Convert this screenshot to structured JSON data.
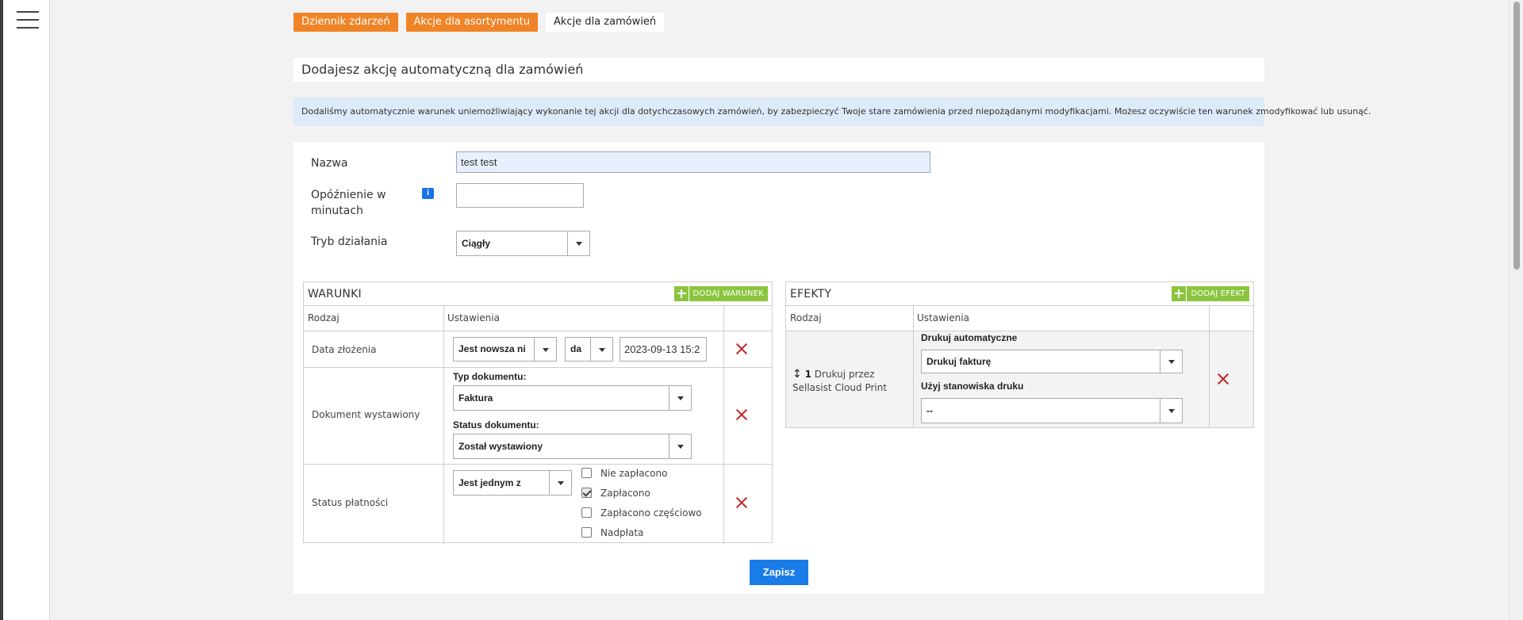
{
  "nav": {
    "menu_icon": "hamburger-menu-icon"
  },
  "tabs": [
    {
      "label": "Dziennik zdarzeń"
    },
    {
      "label": "Akcje dla asortymentu"
    },
    {
      "label": "Akcje dla zamówień"
    }
  ],
  "page_title": "Dodajesz akcję automatyczną dla zamówień",
  "info_message": "Dodaliśmy automatycznie warunek uniemożliwiający wykonanie tej akcji dla dotychczasowych zamówień, by zabezpieczyć Twoje stare zamówienia przed niepożądanymi modyfikacjami. Możesz oczywiście ten warunek zmodyfikować lub usunąć.",
  "form": {
    "name_label": "Nazwa",
    "name_value": "test test",
    "delay_label_line1": "Opóźnienie w",
    "delay_label_line2": "minutach",
    "delay_value": "",
    "delay_info_icon": "i",
    "mode_label": "Tryb działania",
    "mode_value": "Ciągły"
  },
  "conditions": {
    "title": "WARUNKI",
    "add_label": "DODAJ WARUNEK",
    "col_type": "Rodzaj",
    "col_settings": "Ustawienia",
    "rows": [
      {
        "label": "Data złożenia",
        "operator": "Jest nowsza ni",
        "unit": "da",
        "date": "2023-09-13 15:2"
      },
      {
        "label": "Dokument wystawiony",
        "doc_type_label": "Typ dokumentu:",
        "doc_type_value": "Faktura",
        "doc_status_label": "Status dokumentu:",
        "doc_status_value": "Został wystawiony"
      },
      {
        "label": "Status płatności",
        "operator": "Jest jednym z",
        "options": [
          {
            "label": "Nie zapłacono",
            "checked": false
          },
          {
            "label": "Zapłacono",
            "checked": true
          },
          {
            "label": "Zapłacono częściowo",
            "checked": false
          },
          {
            "label": "Nadpłata",
            "checked": false
          }
        ]
      }
    ]
  },
  "effects": {
    "title": "EFEKTY",
    "add_label": "DODAJ EFEKT",
    "col_type": "Rodzaj",
    "col_settings": "Ustawienia",
    "rows": [
      {
        "drag_icon": "↕",
        "count": "1",
        "label_line1": "Drukuj przez",
        "label_line2": "Sellasist Cloud Print",
        "auto_print_label": "Drukuj automatyczne",
        "auto_print_value": "Drukuj fakturę",
        "station_label": "Użyj stanowiska druku",
        "station_value": "--"
      }
    ]
  },
  "save_label": "Zapisz",
  "colors": {
    "tab_orange": "#ef8427",
    "add_green": "#8bc53f",
    "save_blue": "#1a7ce8",
    "delete_red": "#c62828",
    "info_bg": "#ddeaf8"
  }
}
